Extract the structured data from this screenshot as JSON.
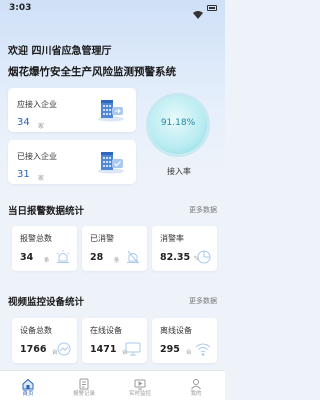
{
  "status_bar": {
    "time": "3:03"
  },
  "header": {
    "welcome": "欢迎 四川省应急管理厅",
    "system_title": "烟花爆竹安全生产风险监测预警系统"
  },
  "access": {
    "required_label": "应接入企业",
    "required_value": "34",
    "required_unit": "家",
    "connected_label": "已接入企业",
    "connected_value": "31",
    "connected_unit": "家",
    "rate_value": "91.18%",
    "rate_label": "接入率"
  },
  "alarm_section": {
    "title": "当日报警数据统计",
    "more": "更多数据",
    "items": [
      {
        "label": "报警总数",
        "value": "34",
        "unit": "条"
      },
      {
        "label": "已消警",
        "value": "28",
        "unit": "条"
      },
      {
        "label": "消警率",
        "value": "82.35",
        "unit": "%"
      }
    ]
  },
  "video_section": {
    "title": "视频监控设备统计",
    "more": "更多数据",
    "items": [
      {
        "label": "设备总数",
        "value": "1766",
        "unit": "台"
      },
      {
        "label": "在线设备",
        "value": "1471",
        "unit": "台"
      },
      {
        "label": "离线设备",
        "value": "295",
        "unit": "台"
      }
    ]
  },
  "tabbar": {
    "items": [
      {
        "label": "首页",
        "icon": "home-icon"
      },
      {
        "label": "报警记录",
        "icon": "alarm-record-icon"
      },
      {
        "label": "实时监控",
        "icon": "monitor-icon"
      },
      {
        "label": "我的",
        "icon": "user-icon"
      }
    ]
  },
  "colors": {
    "accent": "#2a62b8",
    "rate_circle": "#b8ecf1",
    "icon_light_blue": "#a9c8ef"
  }
}
